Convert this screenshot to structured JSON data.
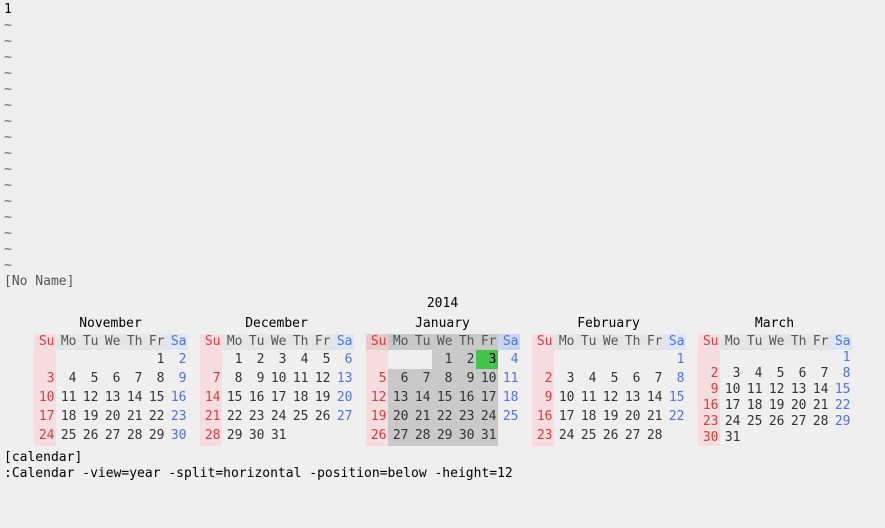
{
  "buffer": {
    "first_line": "  1",
    "filename": "[No Name]"
  },
  "year_label": "2014",
  "months": [
    {
      "name": "November",
      "current": false,
      "weeks": [
        [
          "",
          "",
          "",
          "",
          "",
          "1",
          "2"
        ],
        [
          "3",
          "4",
          "5",
          "6",
          "7",
          "8",
          "9"
        ],
        [
          "10",
          "11",
          "12",
          "13",
          "14",
          "15",
          "16"
        ],
        [
          "17",
          "18",
          "19",
          "20",
          "21",
          "22",
          "23"
        ],
        [
          "24",
          "25",
          "26",
          "27",
          "28",
          "29",
          "30"
        ]
      ]
    },
    {
      "name": "December",
      "current": false,
      "weeks": [
        [
          "",
          "1",
          "2",
          "3",
          "4",
          "5",
          "6"
        ],
        [
          "7",
          "8",
          "9",
          "10",
          "11",
          "12",
          "13"
        ],
        [
          "14",
          "15",
          "16",
          "17",
          "18",
          "19",
          "20"
        ],
        [
          "21",
          "22",
          "23",
          "24",
          "25",
          "26",
          "27"
        ],
        [
          "28",
          "29",
          "30",
          "31",
          "",
          "",
          ""
        ]
      ]
    },
    {
      "name": "January",
      "current": true,
      "today": "3",
      "weeks": [
        [
          "",
          "",
          "",
          "1",
          "2",
          "3",
          "4"
        ],
        [
          "5",
          "6",
          "7",
          "8",
          "9",
          "10",
          "11"
        ],
        [
          "12",
          "13",
          "14",
          "15",
          "16",
          "17",
          "18"
        ],
        [
          "19",
          "20",
          "21",
          "22",
          "23",
          "24",
          "25"
        ],
        [
          "26",
          "27",
          "28",
          "29",
          "30",
          "31",
          ""
        ]
      ]
    },
    {
      "name": "February",
      "current": false,
      "weeks": [
        [
          "",
          "",
          "",
          "",
          "",
          "",
          "1"
        ],
        [
          "2",
          "3",
          "4",
          "5",
          "6",
          "7",
          "8"
        ],
        [
          "9",
          "10",
          "11",
          "12",
          "13",
          "14",
          "15"
        ],
        [
          "16",
          "17",
          "18",
          "19",
          "20",
          "21",
          "22"
        ],
        [
          "23",
          "24",
          "25",
          "26",
          "27",
          "28",
          ""
        ]
      ]
    },
    {
      "name": "March",
      "current": false,
      "weeks": [
        [
          "",
          "",
          "",
          "",
          "",
          "",
          "1"
        ],
        [
          "2",
          "3",
          "4",
          "5",
          "6",
          "7",
          "8"
        ],
        [
          "9",
          "10",
          "11",
          "12",
          "13",
          "14",
          "15"
        ],
        [
          "16",
          "17",
          "18",
          "19",
          "20",
          "21",
          "22"
        ],
        [
          "23",
          "24",
          "25",
          "26",
          "27",
          "28",
          "29"
        ],
        [
          "30",
          "31",
          "",
          "",
          "",
          "",
          ""
        ]
      ]
    }
  ],
  "weekday_headers": [
    "Su",
    "Mo",
    "Tu",
    "We",
    "Th",
    "Fr",
    "Sa"
  ],
  "calendar_label": "[calendar]",
  "command_line": ":Calendar -view=year -split=horizontal -position=below -height=12"
}
